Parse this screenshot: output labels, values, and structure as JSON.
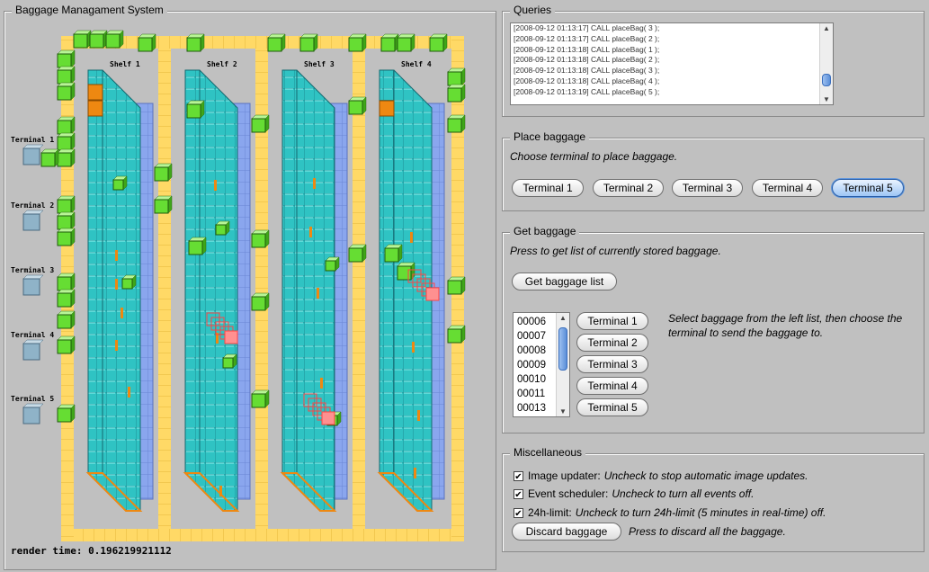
{
  "left_panel": {
    "title": "Baggage Managament System",
    "render_time": "render time: 0.196219921112",
    "shelves": [
      "Shelf 1",
      "Shelf 2",
      "Shelf 3",
      "Shelf 4"
    ],
    "terminals": [
      "Terminal 1",
      "Terminal 2",
      "Terminal 3",
      "Terminal 4",
      "Terminal 5"
    ]
  },
  "queries": {
    "title": "Queries",
    "log": [
      "[2008-09-12 01:13:17] CALL placeBag( 3 );",
      "[2008-09-12 01:13:17] CALL placeBag( 2 );",
      "[2008-09-12 01:13:18] CALL placeBag( 1 );",
      "[2008-09-12 01:13:18] CALL placeBag( 2 );",
      "[2008-09-12 01:13:18] CALL placeBag( 3 );",
      "[2008-09-12 01:13:18] CALL placeBag( 4 );",
      "[2008-09-12 01:13:19] CALL placeBag( 5 );"
    ]
  },
  "place_baggage": {
    "title": "Place baggage",
    "hint": "Choose terminal to place baggage.",
    "buttons": [
      "Terminal 1",
      "Terminal 2",
      "Terminal 3",
      "Terminal 4",
      "Terminal 5"
    ],
    "selected": "Terminal 5"
  },
  "get_baggage": {
    "title": "Get baggage",
    "hint": "Press to get list of currently stored baggage.",
    "list_button": "Get baggage list",
    "bags": [
      "00006",
      "00007",
      "00008",
      "00009",
      "00010",
      "00011",
      "00013"
    ],
    "terminal_buttons": [
      "Terminal 1",
      "Terminal 2",
      "Terminal 3",
      "Terminal 4",
      "Terminal 5"
    ],
    "instructions": "Select baggage from the left list, then choose the terminal to send the baggage to."
  },
  "misc": {
    "title": "Miscellaneous",
    "image_updater": {
      "label": "Image updater:",
      "hint": "Uncheck to stop automatic image updates.",
      "checked": true
    },
    "event_scheduler": {
      "label": "Event scheduler:",
      "hint": "Uncheck to turn all events off.",
      "checked": true
    },
    "limit_24h": {
      "label": "24h-limit:",
      "hint": "Uncheck to turn 24h-limit (5 minutes in real-time) off.",
      "checked": true
    },
    "discard_button": "Discard baggage",
    "discard_hint": "Press to discard all the baggage."
  },
  "colors": {
    "background": "#c0c0c0",
    "conveyor": "#ffd966",
    "bag_green": "#66dd33",
    "shelf_cyan": "#33cccc",
    "shelf_blue": "#88a8ee",
    "bag_orange": "#ee8811",
    "terminal_box": "#8fb3c8",
    "moving_red": "#ff4444"
  }
}
